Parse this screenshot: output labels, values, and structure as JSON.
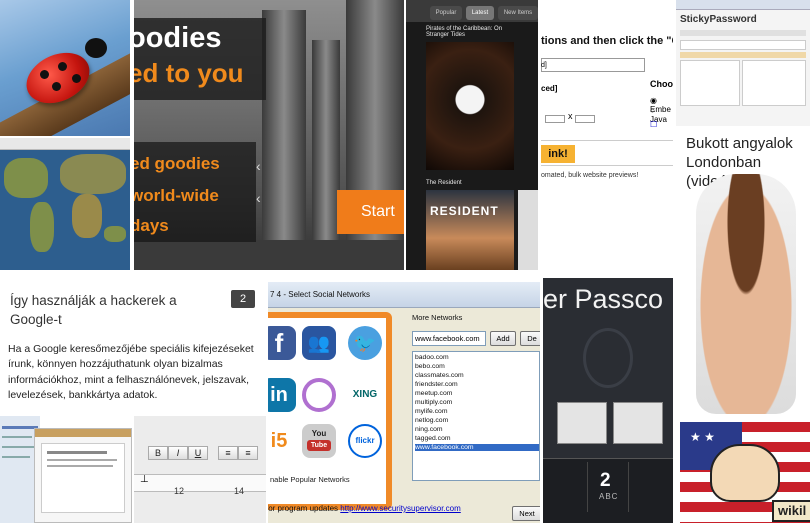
{
  "goodies": {
    "hero_line1": "oodies",
    "hero_line2": "ed to you",
    "line_a": "ed goodies",
    "line_b": "world-wide",
    "line_c": "days",
    "start_label": "Start"
  },
  "movies": {
    "tabs": [
      "Popular",
      "Latest",
      "New Items"
    ],
    "poster1_caption": "Pirates of the Caribbean: On Stranger Tides",
    "poster2_caption": "The Resident",
    "poster2_title": "RESIDENT"
  },
  "form": {
    "instruction": "tions and then click the \"C",
    "choose": "Choos",
    "option1": "Embe",
    "option2": "Java",
    "field_label": "d]",
    "field_label2": "ced]",
    "cross": "x",
    "button_label": "ink!",
    "footer": "omated, bulk website previews!"
  },
  "sticky": {
    "brand": "StickyPassword"
  },
  "bukott": {
    "title": "Bukott angyalok Londonban (videó)"
  },
  "article": {
    "title": "Így használják a hackerek a Google-t",
    "badge": "2",
    "body": "Ha a Google keresőmezőjébe speciális kifejezéseket írunk, könnyen hozzájuthatunk olyan bizalmas információkhoz, mint a felhasználónevek, jelszavak, levelezések, bankkártya adatok."
  },
  "editor": {
    "buttons": [
      "B",
      "I",
      "U"
    ],
    "ruler_12": "12",
    "ruler_14": "14"
  },
  "social": {
    "title": "7 4 - Select Social Networks",
    "more_label": "More Networks",
    "input_value": "www.facebook.com",
    "add_label": "Add",
    "de_label": "De",
    "networks": [
      "badoo.com",
      "bebo.com",
      "classmates.com",
      "friendster.com",
      "meetup.com",
      "multiply.com",
      "mylife.com",
      "netlog.com",
      "ning.com",
      "tagged.com",
      "www.facebook.com"
    ],
    "enable_text": "nable Popular Networks",
    "check_text": "for program updates",
    "url_text": "http://www.securitysupervisor.com",
    "next_label": "Next",
    "icon_xing": "XING",
    "icon_flickr": "flickr",
    "icon_you": "You",
    "icon_tube": "Tube"
  },
  "passcode": {
    "heading": "er Passco",
    "key_number": "2",
    "key_letters": "ABC"
  },
  "cartoon": {
    "label": "wikil"
  },
  "colors": {
    "orange": "#f08a1c",
    "facebook": "#3b5998",
    "selection": "#316ac5"
  }
}
